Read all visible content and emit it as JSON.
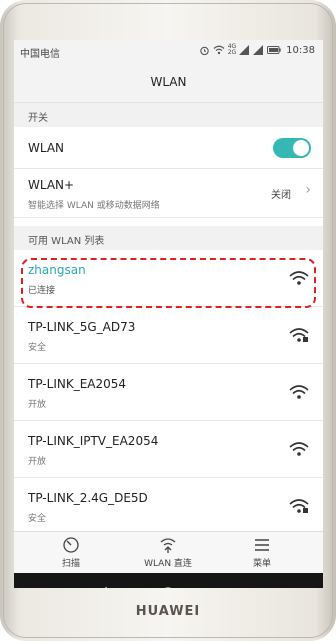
{
  "status": {
    "carrier": "中国电信",
    "time": "10:38",
    "signal": "4G",
    "signal2": "2G"
  },
  "app": {
    "title": "WLAN"
  },
  "sections": {
    "switch": "开关",
    "available": "可用 WLAN 列表"
  },
  "wlan_toggle": {
    "label": "WLAN",
    "on": true
  },
  "wlan_plus": {
    "label": "WLAN+",
    "desc": "智能选择 WLAN 或移动数据网络",
    "value": "关闭"
  },
  "networks": [
    {
      "ssid": "zhangsan",
      "status": "已连接"
    },
    {
      "ssid": "TP-LINK_5G_AD73",
      "status": "安全"
    },
    {
      "ssid": "TP-LINK_EA2054",
      "status": "开放"
    },
    {
      "ssid": "TP-LINK_IPTV_EA2054",
      "status": "开放"
    },
    {
      "ssid": "TP-LINK_2.4G_DE5D",
      "status": "安全"
    }
  ],
  "bottom": {
    "scan": "扫描",
    "direct": "WLAN 直连",
    "menu": "菜单"
  },
  "brand": "HUAWEI",
  "colors": {
    "accent": "#35b8b3",
    "connected": "#2aa8b0",
    "highlight": "#e02020"
  }
}
